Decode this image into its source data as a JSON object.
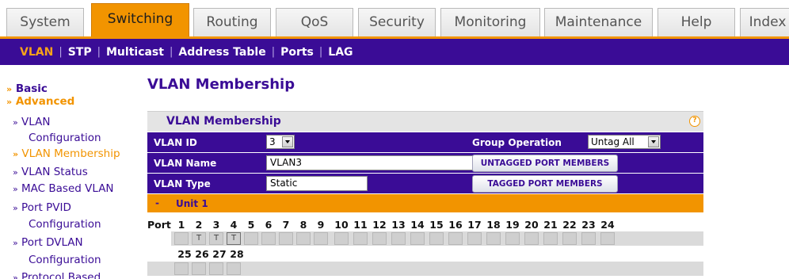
{
  "top_tabs": [
    "System",
    "Switching",
    "Routing",
    "QoS",
    "Security",
    "Monitoring",
    "Maintenance",
    "Help",
    "Index"
  ],
  "active_top_tab": "Switching",
  "sub_nav": [
    "VLAN",
    "STP",
    "Multicast",
    "Address Table",
    "Ports",
    "LAG"
  ],
  "active_sub_nav": "VLAN",
  "left_menu": {
    "basic": "Basic",
    "advanced": "Advanced",
    "items": [
      [
        "VLAN",
        "Configuration"
      ],
      [
        "VLAN Membership"
      ],
      [
        "VLAN Status"
      ],
      [
        "MAC Based VLAN"
      ],
      [
        "Port PVID",
        "Configuration"
      ],
      [
        "Port DVLAN",
        "Configuration"
      ],
      [
        "Protocol Based"
      ]
    ]
  },
  "page_title": "VLAN Membership",
  "panel": {
    "title": "VLAN Membership",
    "help": "?",
    "vlan_id_label": "VLAN ID",
    "vlan_id_value": "3",
    "group_operation_label": "Group Operation",
    "group_operation_value": "Untag All",
    "vlan_name_label": "VLAN Name",
    "vlan_name_value": "VLAN3",
    "untagged_button": "UNTAGGED PORT MEMBERS",
    "vlan_type_label": "VLAN Type",
    "vlan_type_value": "Static",
    "tagged_button": "TAGGED PORT MEMBERS",
    "unit_toggle": "-",
    "unit_label": "Unit 1",
    "port_label": "Port",
    "ports_row1": [
      "1",
      "2",
      "3",
      "4",
      "5",
      "6",
      "7",
      "8",
      "9",
      "10",
      "11",
      "12",
      "13",
      "14",
      "15",
      "16",
      "17",
      "18",
      "19",
      "20",
      "21",
      "22",
      "23",
      "24"
    ],
    "ports_row2": [
      "25",
      "26",
      "27",
      "28"
    ],
    "port_marks": {
      "2": "T",
      "3": "T",
      "4": "T"
    }
  },
  "colors": {
    "brand_purple": "#3a0c96",
    "accent_orange": "#f29400"
  }
}
